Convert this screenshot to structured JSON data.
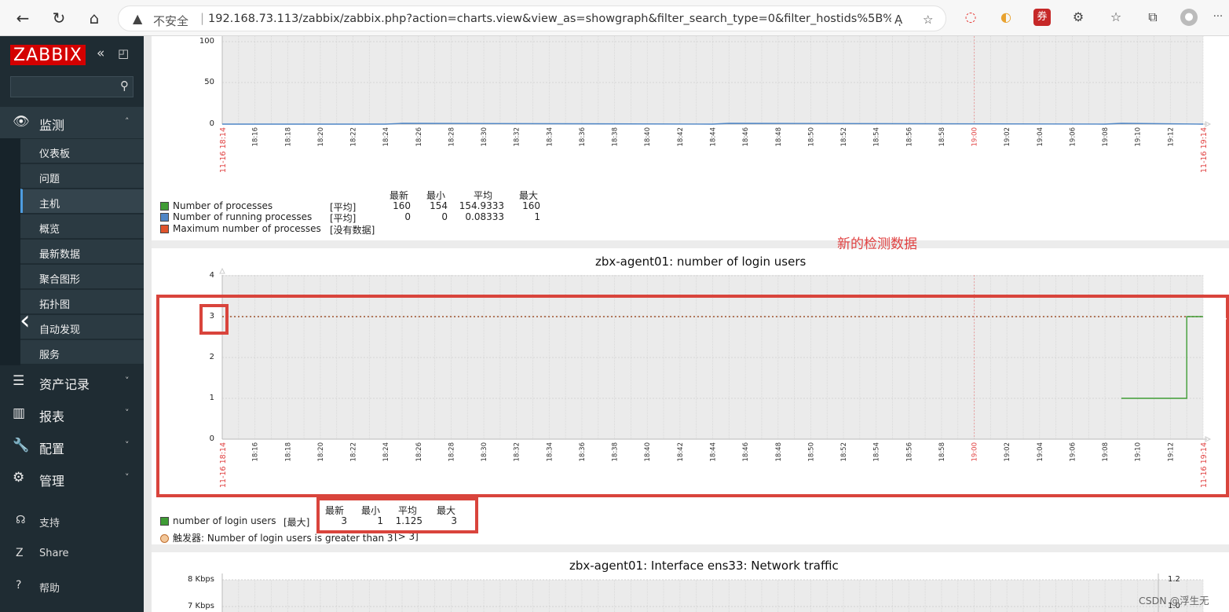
{
  "browser": {
    "security_label": "不安全",
    "url": "192.168.73.113/zabbix/zabbix.php?action=charts.view&view_as=showgraph&filter_search_type=0&filter_hostids%5B%5D=10437&filt...",
    "reader_label": "Aͅ"
  },
  "sidebar": {
    "logo": "ZABBIX",
    "monitoring": {
      "label": "监测",
      "items": [
        "仪表板",
        "问题",
        "主机",
        "概览",
        "最新数据",
        "聚合图形",
        "拓扑图",
        "自动发现",
        "服务"
      ],
      "active_index": 2
    },
    "sections": [
      {
        "label": "资产记录"
      },
      {
        "label": "报表"
      },
      {
        "label": "配置"
      },
      {
        "label": "管理"
      }
    ],
    "bottom": [
      {
        "label": "支持"
      },
      {
        "label": "Share"
      },
      {
        "label": "帮助"
      }
    ]
  },
  "graph1": {
    "y_ticks": [
      "100",
      "50",
      "0"
    ],
    "legend_headers": [
      "最新",
      "最小",
      "平均",
      "最大"
    ],
    "legend": [
      {
        "name": "Number of processes",
        "func": "[平均]",
        "last": "160",
        "min": "154",
        "avg": "154.9333",
        "max": "160",
        "color": "#3f9c35"
      },
      {
        "name": "Number of running processes",
        "func": "[平均]",
        "last": "0",
        "min": "0",
        "avg": "0.08333",
        "max": "1",
        "color": "#4f86c6"
      },
      {
        "name": "Maximum number of processes",
        "func": "[没有数据]",
        "last": "",
        "min": "",
        "avg": "",
        "max": "",
        "color": "#e0542c"
      }
    ]
  },
  "annotation": "新的检测数据",
  "graph2": {
    "title": "zbx-agent01: number of login users",
    "y_ticks": [
      "4",
      "3",
      "2",
      "1",
      "0"
    ],
    "legend_headers": [
      "最新",
      "最小",
      "平均",
      "最大"
    ],
    "legend": [
      {
        "name": "number of login users",
        "func": "[最大]",
        "last": "3",
        "min": "1",
        "avg": "1.125",
        "max": "3",
        "color": "#3f9c35"
      }
    ],
    "trigger": "触发器: Number of login users is greater than 3",
    "trigger_cond": "[> 3]"
  },
  "graph3": {
    "title": "zbx-agent01: Interface ens33: Network traffic",
    "y_ticks_left": [
      "8 Kbps",
      "7 Kbps"
    ],
    "y_ticks_right": [
      "1.2",
      "1.0"
    ]
  },
  "time_axis": {
    "start_label": "11-16 18:14",
    "end_label": "11-16 19:14",
    "ticks": [
      "18:16",
      "18:18",
      "18:20",
      "18:22",
      "18:24",
      "18:26",
      "18:28",
      "18:30",
      "18:32",
      "18:34",
      "18:36",
      "18:38",
      "18:40",
      "18:42",
      "18:44",
      "18:46",
      "18:48",
      "18:50",
      "18:52",
      "18:54",
      "18:56",
      "18:58",
      "19:00",
      "19:02",
      "19:04",
      "19:06",
      "19:08",
      "19:10",
      "19:12"
    ],
    "highlight_tick": "19:00",
    "highlight_color": "#e04040"
  },
  "chart_data": [
    {
      "type": "line",
      "title": "",
      "x_range": [
        "11-16 18:14",
        "11-16 19:14"
      ],
      "ylim": [
        0,
        100
      ],
      "series": [
        {
          "name": "Number of running processes",
          "x": [
            "18:14",
            "18:24",
            "18:25",
            "18:44",
            "18:45",
            "19:08",
            "19:09",
            "19:14"
          ],
          "values": [
            0,
            0,
            1,
            0,
            1,
            0,
            1,
            0
          ]
        }
      ]
    },
    {
      "type": "line",
      "title": "zbx-agent01: number of login users",
      "x_range": [
        "11-16 18:14",
        "11-16 19:14"
      ],
      "ylim": [
        0,
        4
      ],
      "series": [
        {
          "name": "number of login users",
          "x": [
            "19:09",
            "19:13",
            "19:13",
            "19:14"
          ],
          "values": [
            1,
            1,
            3,
            3
          ]
        }
      ],
      "trigger_threshold": 3
    }
  ],
  "watermark": "CSDN @浮生无"
}
